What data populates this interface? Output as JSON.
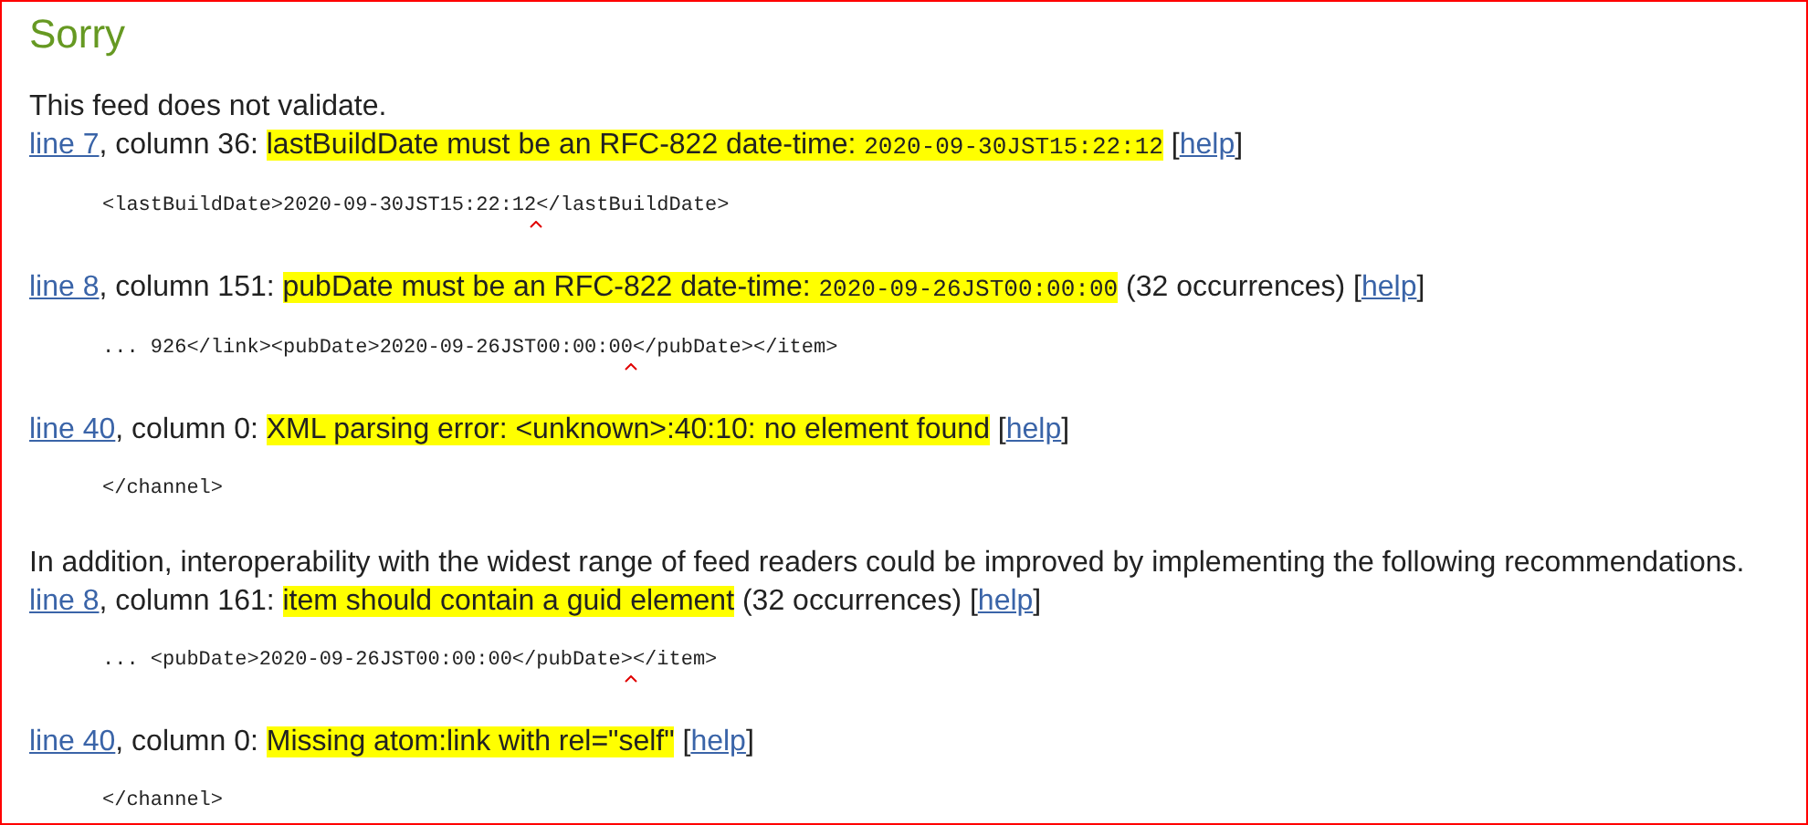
{
  "title": "Sorry",
  "intro": "This feed does not validate.",
  "errors": [
    {
      "line": "line 7",
      "column": ", column 36: ",
      "message": "lastBuildDate must be an RFC-822 date-time: ",
      "value": "2020-09-30JST15:22:12",
      "help": {
        "open": "[",
        "label": "help",
        "close": "]"
      },
      "code_before": "<lastBuildDate>2020-09-30JST15:22:12",
      "code_after": "</lastBuildDate>"
    },
    {
      "line": "line 8",
      "column": ", column 151: ",
      "message": "pubDate must be an RFC-822 date-time: ",
      "value": "2020-09-26JST00:00:00",
      "occurrences": "(32 occurrences)",
      "help": {
        "open": "[",
        "label": "help",
        "close": "]"
      },
      "code_before": "... 926</link><pubDate>2020-09-26JST00:00:00",
      "code_after": "</pubDate></item>"
    },
    {
      "line": "line 40",
      "column": ", column 0: ",
      "message": "XML parsing error: <unknown>:40:10: no element found",
      "help": {
        "open": "[",
        "label": "help",
        "close": "]"
      },
      "code_before": "</channel>"
    }
  ],
  "recommendation_intro": "In addition, interoperability with the widest range of feed readers could be improved by implementing the following recommendations.",
  "warnings": [
    {
      "line": "line 8",
      "column": ", column 161: ",
      "message": "item should contain a guid element",
      "occurrences": "(32 occurrences)",
      "help": {
        "open": "[",
        "label": "help",
        "close": "]"
      },
      "code_before": "... <pubDate>2020-09-26JST00:00:00</pubDate>",
      "code_after": "</item>"
    },
    {
      "line": "line 40",
      "column": ", column 0: ",
      "message": "Missing atom:link with rel=\"self\"",
      "help": {
        "open": "[",
        "label": "help",
        "close": "]"
      },
      "code_before": "</channel>"
    }
  ]
}
